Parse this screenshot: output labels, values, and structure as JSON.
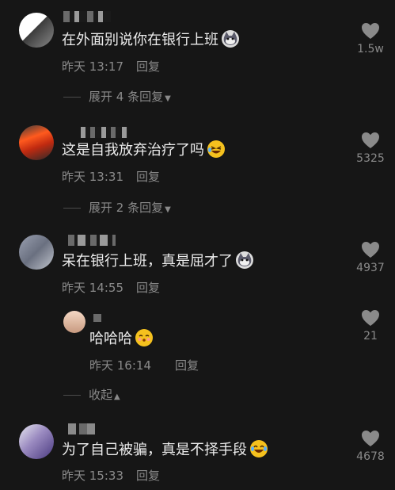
{
  "comments": [
    {
      "text": "在外面别说你在银行上班",
      "emoji": "cat-face-icon",
      "time": "昨天 13:17",
      "reply": "回复",
      "likes": "1.5w",
      "expand": "展开 4 条回复"
    },
    {
      "text": "这是自我放弃治疗了吗",
      "emoji": "laughing-face-icon",
      "time": "昨天 13:31",
      "reply": "回复",
      "likes": "5325",
      "expand": "展开 2 条回复"
    },
    {
      "text": "呆在银行上班，真是屈才了",
      "emoji": "cat-face-icon",
      "time": "昨天 14:55",
      "reply": "回复",
      "likes": "4937",
      "subreply": {
        "text": "哈哈哈",
        "emoji": "blush-face-icon",
        "time": "昨天 16:14",
        "reply": "回复",
        "likes": "21"
      },
      "collapse": "收起"
    },
    {
      "text": "为了自己被骗，真是不择手段",
      "emoji": "tears-of-joy-face-icon",
      "time": "昨天 15:33",
      "reply": "回复",
      "likes": "4678"
    }
  ]
}
